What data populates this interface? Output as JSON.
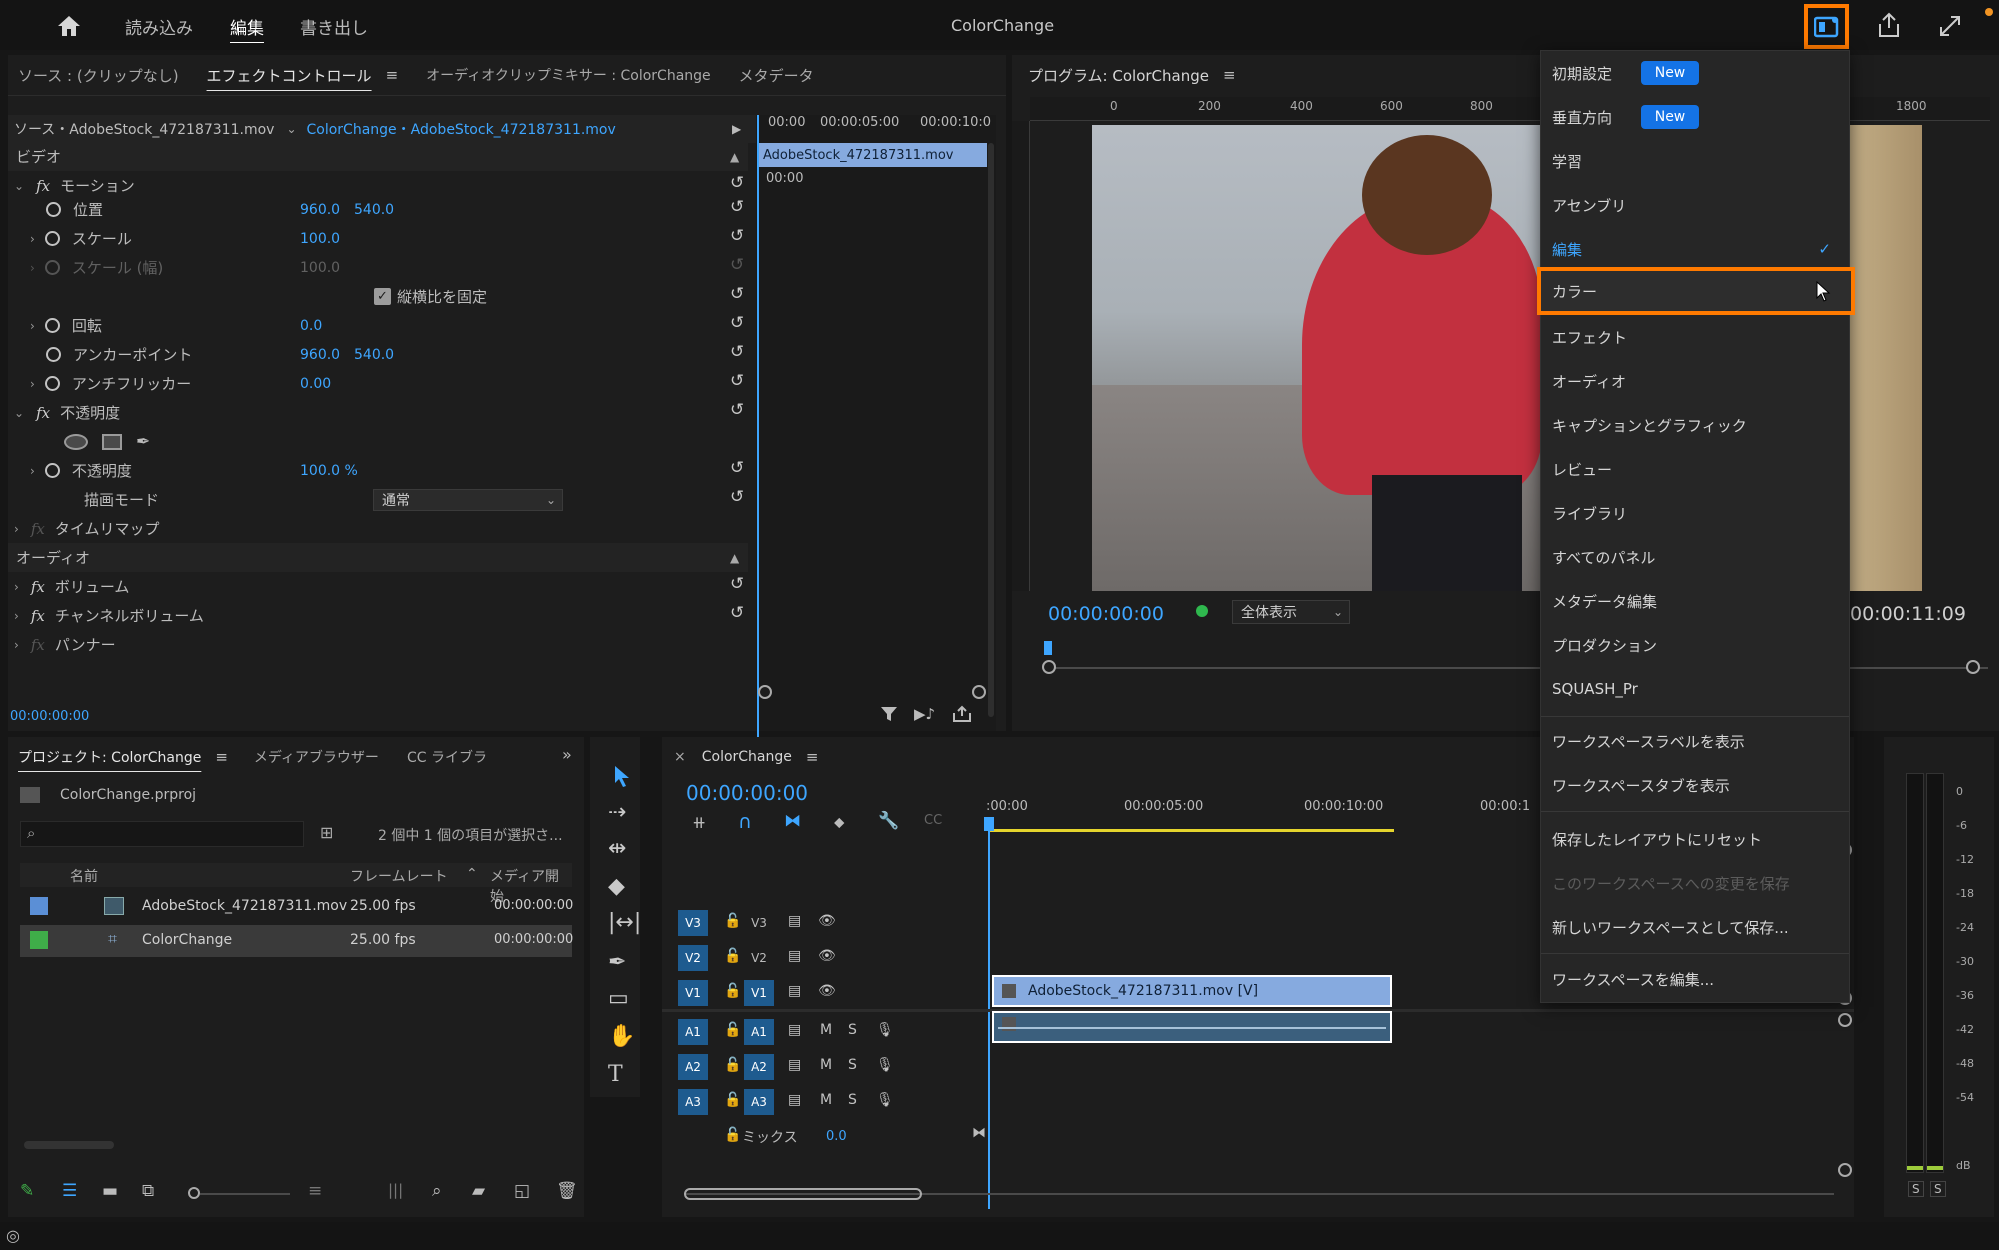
{
  "topbar": {
    "nav": [
      "読み込み",
      "編集",
      "書き出し"
    ],
    "active_index": 1,
    "title": "ColorChange"
  },
  "source_panel": {
    "tabs": [
      "ソース : (クリップなし)",
      "エフェクトコントロール",
      "オーディオクリップミキサー : ColorChange",
      "メタデータ"
    ],
    "active_tab": 1,
    "source_label": "ソース・AdobeStock_472187311.mov",
    "clip_label": "ColorChange・AdobeStock_472187311.mov",
    "mini_ruler": [
      "00:00",
      "00:00:05:00",
      "00:00:10:0"
    ],
    "clip_bar": "AdobeStock_472187311.mov",
    "sections": {
      "video": "ビデオ",
      "audio": "オーディオ"
    },
    "motion": "モーション",
    "position": {
      "label": "位置",
      "x": "960.0",
      "y": "540.0"
    },
    "scale": {
      "label": "スケール",
      "value": "100.0"
    },
    "scale_width": {
      "label": "スケール (幅)",
      "value": "100.0"
    },
    "uniform": "縦横比を固定",
    "rotation": {
      "label": "回転",
      "value": "0.0"
    },
    "anchor": {
      "label": "アンカーポイント",
      "x": "960.0",
      "y": "540.0"
    },
    "antiflicker": {
      "label": "アンチフリッカー",
      "value": "0.00"
    },
    "opacity_section": "不透明度",
    "opacity": {
      "label": "不透明度",
      "value": "100.0 %"
    },
    "blend": {
      "label": "描画モード",
      "value": "通常"
    },
    "time_remap": "タイムリマップ",
    "volume": "ボリューム",
    "channel_volume": "チャンネルボリューム",
    "panner": "パンナー",
    "timecode": "00:00:00:00"
  },
  "program": {
    "title": "プログラム: ColorChange",
    "ruler": [
      "0",
      "200",
      "400",
      "600",
      "800",
      "1800"
    ],
    "timecode": "00:00:00:00",
    "fit": "全体表示",
    "duration": "00:00:11:09"
  },
  "project": {
    "tabs": [
      "プロジェクト: ColorChange",
      "メディアブラウザー",
      "CC ライブラ"
    ],
    "file": "ColorChange.prproj",
    "selection": "2 個中 1 個の項目が選択さ...",
    "columns": [
      "名前",
      "フレームレート",
      "メディア開始"
    ],
    "rows": [
      {
        "name": "AdobeStock_472187311.mov",
        "fps": "25.00 fps",
        "start": "00:00:00:00",
        "color": "#5b8fd6"
      },
      {
        "name": "ColorChange",
        "fps": "25.00 fps",
        "start": "00:00:00:00",
        "color": "#3fae49"
      }
    ]
  },
  "timeline": {
    "title": "ColorChange",
    "timecode": "00:00:00:00",
    "ruler": [
      ":00:00",
      "00:00:05:00",
      "00:00:10:00",
      "00:00:1"
    ],
    "video_tracks": [
      "V3",
      "V2",
      "V1"
    ],
    "audio_tracks": [
      "A1",
      "A2",
      "A3"
    ],
    "mute": "M",
    "solo": "S",
    "mix": {
      "label": "ミックス",
      "value": "0.0"
    },
    "clip": "AdobeStock_472187311.mov [V]"
  },
  "meter": {
    "scale": [
      "0",
      "-6",
      "-12",
      "-18",
      "-24",
      "-30",
      "-36",
      "-42",
      "-48",
      "-54",
      "dB"
    ],
    "solo": [
      "S",
      "S"
    ]
  },
  "workspace_menu": {
    "items": [
      {
        "label": "初期設定",
        "badge": "New"
      },
      {
        "label": "垂直方向",
        "badge": "New"
      },
      {
        "label": "学習"
      },
      {
        "label": "アセンブリ"
      },
      {
        "label": "編集",
        "checked": true
      },
      {
        "label": "カラー",
        "highlighted": true
      },
      {
        "label": "エフェクト"
      },
      {
        "label": "オーディオ"
      },
      {
        "label": "キャプションとグラフィック"
      },
      {
        "label": "レビュー"
      },
      {
        "label": "ライブラリ"
      },
      {
        "label": "すべてのパネル"
      },
      {
        "label": "メタデータ編集"
      },
      {
        "label": "プロダクション"
      },
      {
        "label": "SQUASH_Pr"
      },
      {
        "label": "ワークスペースラベルを表示"
      },
      {
        "label": "ワークスペースタブを表示"
      },
      {
        "label": "保存したレイアウトにリセット"
      },
      {
        "label": "このワークスペースへの変更を保存",
        "disabled": true
      },
      {
        "label": "新しいワークスペースとして保存..."
      },
      {
        "label": "ワークスペースを編集..."
      }
    ],
    "accent": "#ff7a00"
  }
}
